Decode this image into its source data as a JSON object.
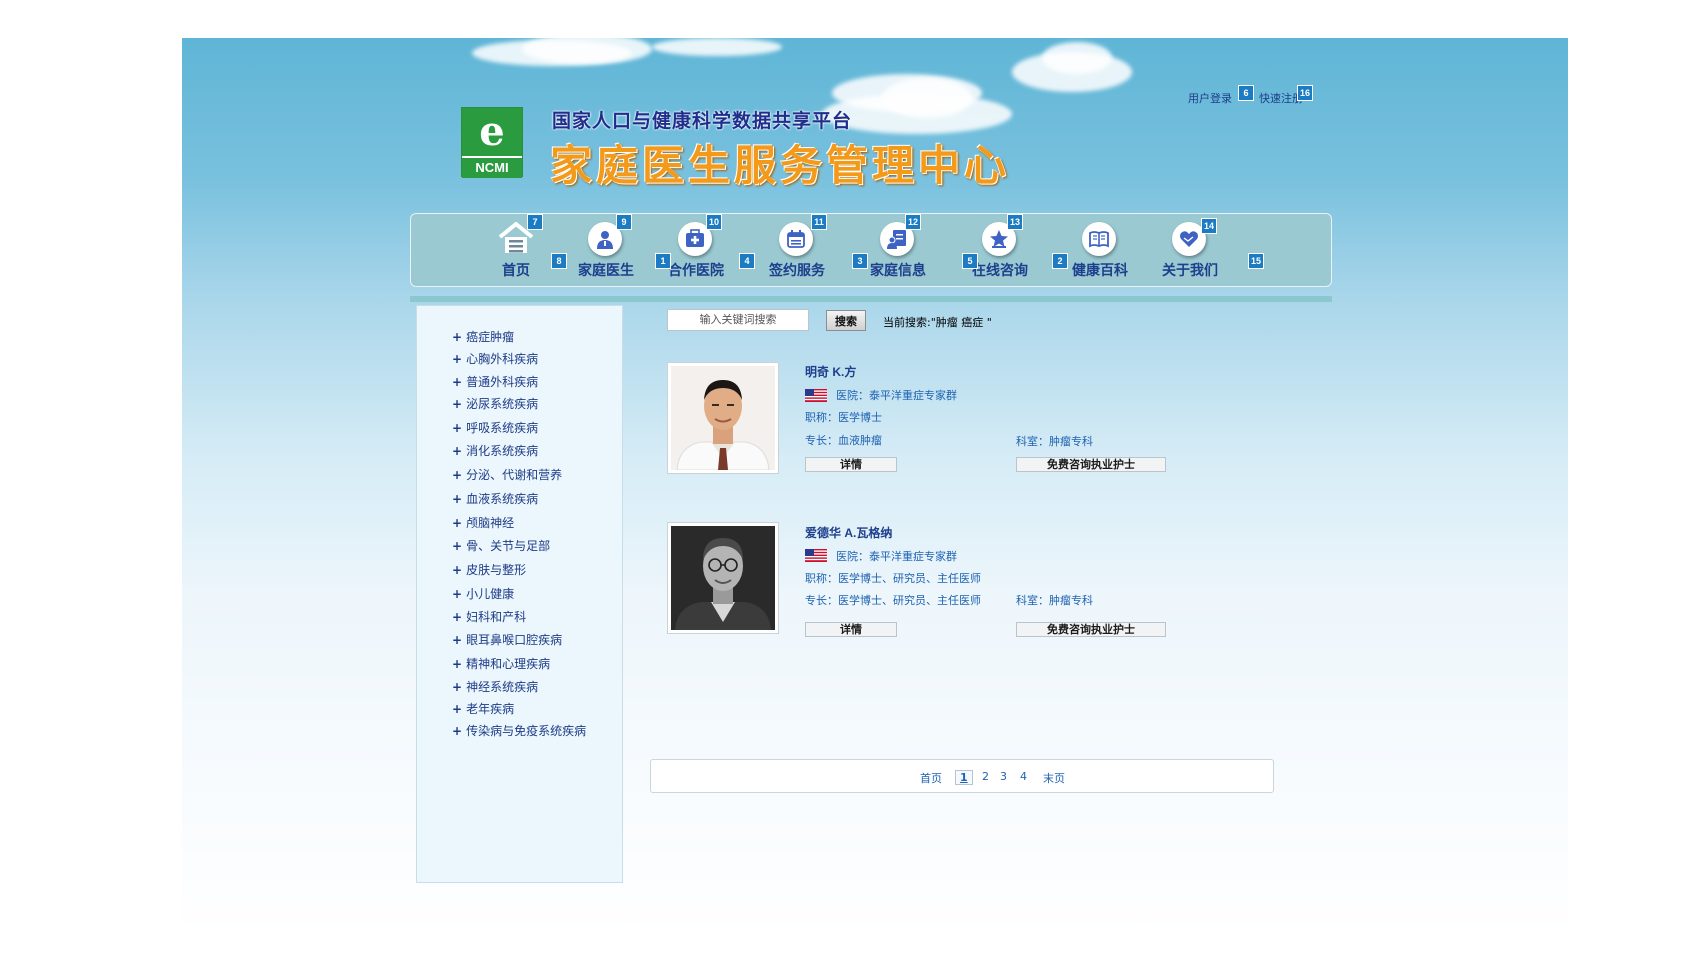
{
  "header": {
    "logo_letter": "e",
    "logo_text": "NCMI",
    "subtitle": "国家人口与健康科学数据共享平台",
    "title": "家庭医生服务管理中心",
    "login": "用户登录",
    "login_badge": "6",
    "register": "快速注册",
    "register_badge": "16"
  },
  "nav": {
    "items": [
      {
        "label": "首页",
        "icon": "home-icon",
        "badge": "7"
      },
      {
        "label": "家庭医生",
        "icon": "doctor-icon",
        "badge": "9"
      },
      {
        "label": "合作医院",
        "icon": "hospital-icon",
        "badge": "10"
      },
      {
        "label": "签约服务",
        "icon": "calendar-icon",
        "badge": "11"
      },
      {
        "label": "家庭信息",
        "icon": "family-info-icon",
        "badge": "12"
      },
      {
        "label": "在线咨询",
        "icon": "star-consult-icon",
        "badge": "13"
      },
      {
        "label": "健康百科",
        "icon": "book-icon",
        "badge": "2"
      },
      {
        "label": "关于我们",
        "icon": "handshake-icon",
        "badge": "14"
      }
    ],
    "side_badges": [
      "8",
      "1",
      "4",
      "3",
      "5",
      "15"
    ]
  },
  "sidebar": {
    "plus": "+",
    "categories": [
      "癌症肿瘤",
      "心胸外科疾病",
      "普通外科疾病",
      "泌尿系统疾病",
      "呼吸系统疾病",
      "消化系统疾病",
      "分泌、代谢和营养",
      "血液系统疾病",
      "颅脑神经",
      "骨、关节与足部",
      "皮肤与整形",
      "小儿健康",
      "妇科和产科",
      "眼耳鼻喉口腔疾病",
      "精神和心理疾病",
      "神经系统疾病",
      "老年疾病",
      "传染病与免疫系统疾病"
    ]
  },
  "search": {
    "placeholder": "输入关键词搜索",
    "button": "搜索",
    "current": "当前搜索:\"肿瘤  癌症  \""
  },
  "doctors": [
    {
      "name": "明奇 K.方",
      "hospital": "医院：泰平洋重症专家群",
      "title": "职称：医学博士",
      "specialty": "专长：血液肿瘤",
      "department": "科室：肿瘤专科",
      "detail": "详情",
      "consult": "免费咨询执业护士"
    },
    {
      "name": "爱德华 A.瓦格纳",
      "hospital": "医院：泰平洋重症专家群",
      "title": "职称：医学博士、研究员、主任医师",
      "specialty": "专长：医学博士、研究员、主任医师",
      "department": "科室：肿瘤专科",
      "detail": "详情",
      "consult": "免费咨询执业护士"
    }
  ],
  "pagination": {
    "first": "首页",
    "pages": [
      "1",
      "2",
      "3",
      "4"
    ],
    "current": "1",
    "last": "末页"
  }
}
